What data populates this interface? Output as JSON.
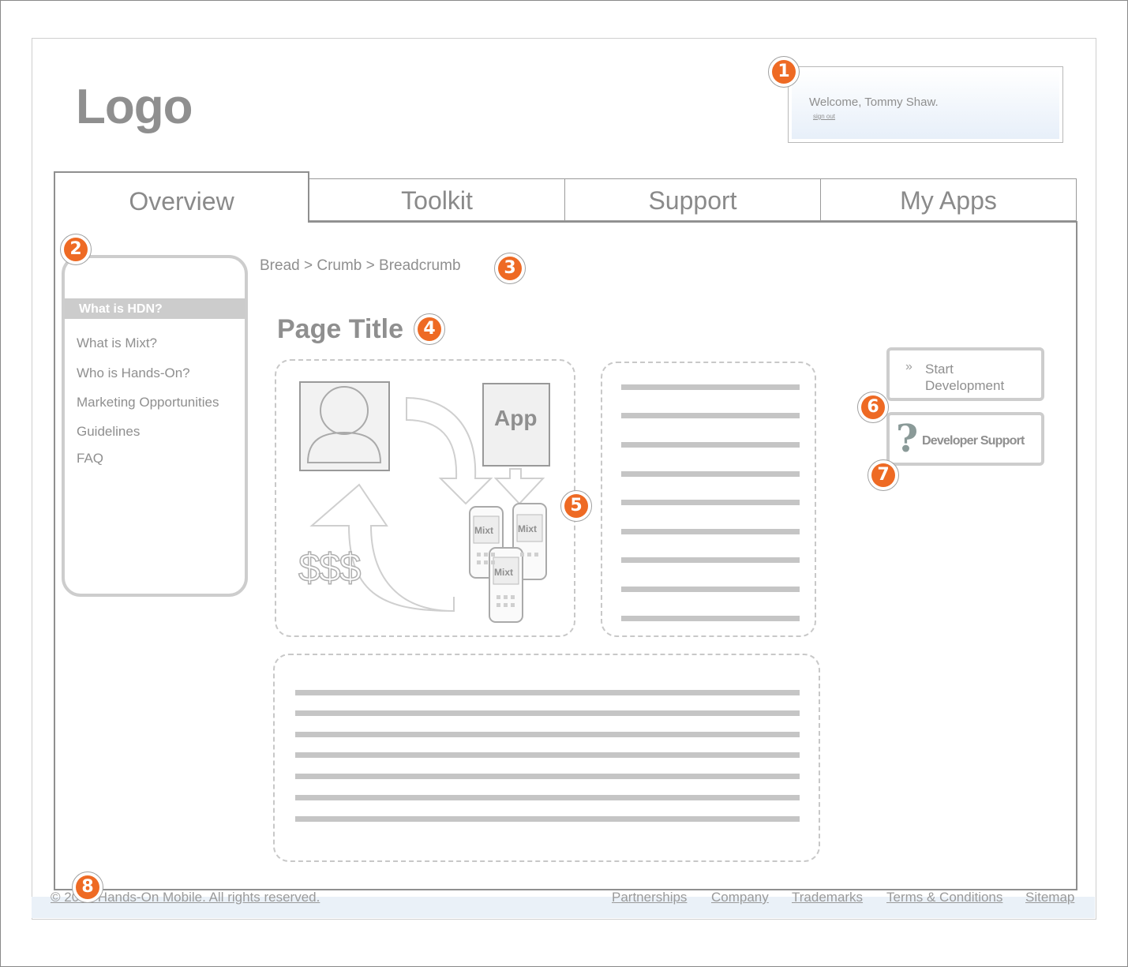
{
  "logo": "Logo",
  "header": {
    "welcome": "Welcome, Tommy Shaw.",
    "signout": "sign out"
  },
  "tabs": [
    {
      "label": "Overview",
      "active": true
    },
    {
      "label": "Toolkit"
    },
    {
      "label": "Support"
    },
    {
      "label": "My Apps"
    }
  ],
  "sidebar": {
    "active_item": "What is HDN?",
    "items": [
      "What is Mixt?",
      "Who is Hands-On?",
      "Marketing Opportunities",
      "Guidelines",
      "FAQ"
    ]
  },
  "breadcrumb": "Bread > Crumb > Breadcrumb",
  "page_title": "Page Title",
  "illustration": {
    "app_label": "App",
    "money_label": "$$$",
    "phone_label": "Mixt"
  },
  "actions": {
    "start_line1": "Start",
    "start_line2": "Development",
    "support_label": "Developer Support"
  },
  "footer": {
    "copyright": "© 2008 Hands-On Mobile. All rights reserved.",
    "links": [
      "Partnerships",
      "Company",
      "Trademarks",
      "Terms & Conditions",
      "Sitemap"
    ]
  },
  "callouts": [
    "1",
    "2",
    "3",
    "4",
    "5",
    "6",
    "7",
    "8"
  ],
  "colors": {
    "callout": "#ee6a24",
    "footer_bg": "#eaf1f8",
    "wireframe_gray": "#cdcdcd"
  }
}
